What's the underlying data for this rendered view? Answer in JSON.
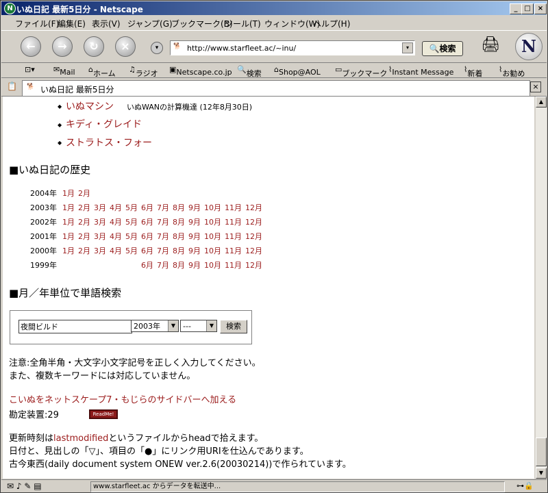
{
  "window": {
    "title": "いぬ日記 最新5日分 - Netscape",
    "min": "_",
    "max": "□",
    "close": "×"
  },
  "menu": [
    "ファイル(F)",
    "編集(E)",
    "表示(V)",
    "ジャンプ(G)",
    "ブックマーク(B)",
    "ツール(T)",
    "ウィンドウ(W)",
    "ヘルプ(H)"
  ],
  "nav": {
    "url": "http://www.starfleet.ac/~inu/",
    "search_label": "検索"
  },
  "personal_toolbar": [
    "Mail",
    "ホーム",
    "ラジオ",
    "Netscape.co.jp",
    "検索",
    "Shop@AOL",
    "ブックマーク",
    "Instant Message",
    "新着",
    "お勧め"
  ],
  "tab": {
    "title": "いぬ日記 最新5日分"
  },
  "page": {
    "list": [
      {
        "link": "いぬマシン",
        "note": "いぬWANの計算機達 (12年8月30日)"
      },
      {
        "link": "キディ・グレイド",
        "note": ""
      },
      {
        "link": "ストラトス・フォー",
        "note": ""
      }
    ],
    "history_heading": "■いぬ日記の歴史",
    "history": [
      {
        "year": "2004年",
        "months": [
          "1月",
          "2月",
          "",
          "",
          "",
          "",
          "",
          "",
          "",
          "",
          "",
          ""
        ]
      },
      {
        "year": "2003年",
        "months": [
          "1月",
          "2月",
          "3月",
          "4月",
          "5月",
          "6月",
          "7月",
          "8月",
          "9月",
          "10月",
          "11月",
          "12月"
        ]
      },
      {
        "year": "2002年",
        "months": [
          "1月",
          "2月",
          "3月",
          "4月",
          "5月",
          "6月",
          "7月",
          "8月",
          "9月",
          "10月",
          "11月",
          "12月"
        ]
      },
      {
        "year": "2001年",
        "months": [
          "1月",
          "2月",
          "3月",
          "4月",
          "5月",
          "6月",
          "7月",
          "8月",
          "9月",
          "10月",
          "11月",
          "12月"
        ]
      },
      {
        "year": "2000年",
        "months": [
          "1月",
          "2月",
          "3月",
          "4月",
          "5月",
          "6月",
          "7月",
          "8月",
          "9月",
          "10月",
          "11月",
          "12月"
        ]
      },
      {
        "year": "1999年",
        "months": [
          "",
          "",
          "",
          "",
          "",
          "6月",
          "7月",
          "8月",
          "9月",
          "10月",
          "11月",
          "12月"
        ]
      }
    ],
    "search_heading": "■月／年単位で単語検索",
    "search": {
      "query": "夜間ビルド",
      "year": "2003年",
      "month": "---",
      "button": "検索"
    },
    "notice1": "注意:全角半角・大文字小文字記号を正しく入力してください。",
    "notice2": "また、複数キーワードには対応していません。",
    "sidebar_link1": "こいぬを",
    "sidebar_link2": "ネットスケープ7",
    "sidebar_link3": "・",
    "sidebar_link4": "もじら",
    "sidebar_link5": "のサイドバーへ加える",
    "counter": "勘定装置:29",
    "readme": "ReadMe!",
    "footer1_pre": "更新時刻は",
    "footer1_link": "lastmodified",
    "footer1_post": "というファイルからheadで拾えます。",
    "footer2": "日付と、見出しの「▽」、項目の「●」にリンク用URIを仕込んであります。",
    "footer3": "古今東西(daily document system ONEW ver.2.6(20030214))で作られています。"
  },
  "status": {
    "message": "www.starfleet.ac からデータを転送中..."
  }
}
